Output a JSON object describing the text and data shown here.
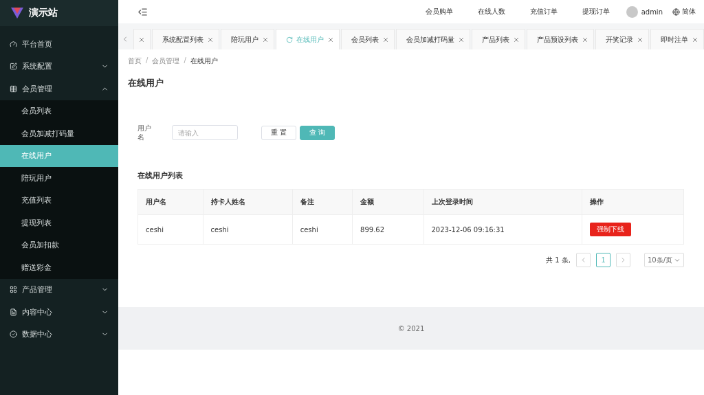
{
  "brand": {
    "title": "演示站"
  },
  "sidebar": {
    "items": [
      {
        "label": "平台首页",
        "selected": false
      },
      {
        "label": "系统配置",
        "expanded": false,
        "selected": false
      },
      {
        "label": "会员管理",
        "expanded": true,
        "selected": false,
        "children": [
          {
            "label": "会员列表",
            "selected": false
          },
          {
            "label": "会员加减打码量",
            "selected": false
          },
          {
            "label": "在线用户",
            "selected": true
          },
          {
            "label": "陪玩用户",
            "selected": false
          },
          {
            "label": "充值列表",
            "selected": false
          },
          {
            "label": "提现列表",
            "selected": false
          },
          {
            "label": "会员加扣款",
            "selected": false
          },
          {
            "label": "赠送彩金",
            "selected": false
          }
        ]
      },
      {
        "label": "产品管理",
        "expanded": false,
        "selected": false
      },
      {
        "label": "内容中心",
        "expanded": false,
        "selected": false
      },
      {
        "label": "数据中心",
        "expanded": false,
        "selected": false
      }
    ]
  },
  "header": {
    "links": [
      "会员购单",
      "在线人数",
      "充值订单",
      "提现订单"
    ],
    "user": "admin",
    "language": "简体"
  },
  "tabs": [
    {
      "selected": false
    },
    {
      "label": "系统配置列表",
      "selected": false
    },
    {
      "label": "陪玩用户",
      "selected": false
    },
    {
      "label": "在线用户",
      "selected": true
    },
    {
      "label": "会员列表",
      "selected": false
    },
    {
      "label": "会员加减打码量",
      "selected": false
    },
    {
      "label": "产品列表",
      "selected": false
    },
    {
      "label": "产品预设列表",
      "selected": false
    },
    {
      "label": "开奖记录",
      "selected": false
    },
    {
      "label": "即时注单",
      "selected": false
    }
  ],
  "breadcrumb": {
    "items": [
      "首页",
      "会员管理",
      "在线用户"
    ],
    "separator": "/"
  },
  "page_title": "在线用户",
  "search": {
    "label": "用户名",
    "placeholder": "请输入",
    "reset": "重 置",
    "submit": "查 询"
  },
  "table": {
    "title": "在线用户列表",
    "columns": [
      "用户名",
      "持卡人姓名",
      "备注",
      "金额",
      "上次登录时间",
      "操作"
    ],
    "rows": [
      {
        "cells": [
          "ceshi",
          "ceshi",
          "ceshi",
          "899.62",
          "2023-12-06 09:16:31"
        ],
        "action": "强制下线"
      }
    ]
  },
  "pagination": {
    "total": "共 1 条,",
    "pages": [
      {
        "label": "1",
        "selected": true
      }
    ],
    "page_size": "10条/页"
  },
  "footer": "© 2021"
}
